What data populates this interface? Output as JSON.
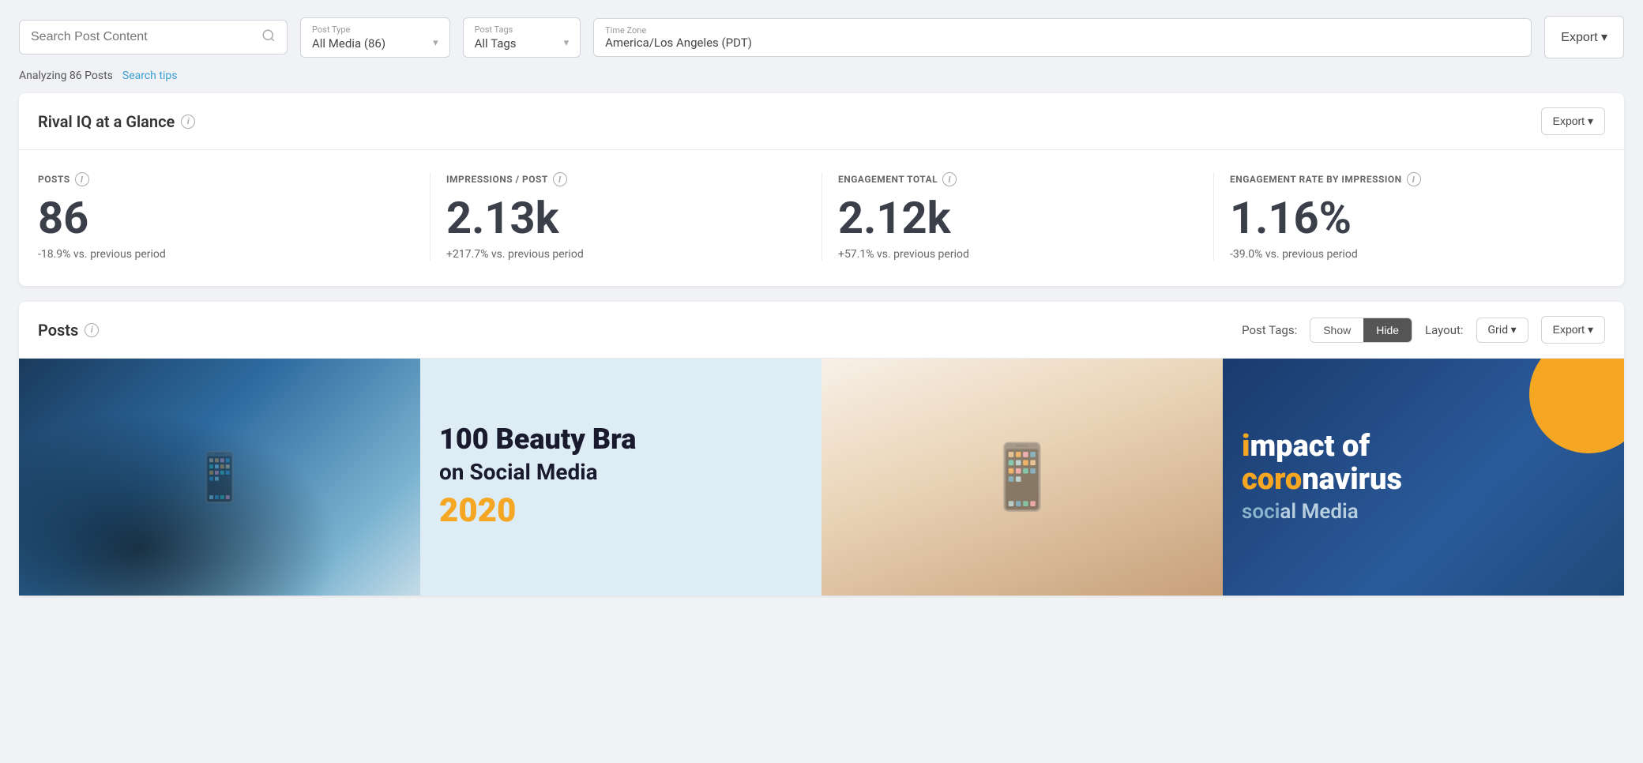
{
  "toolbar": {
    "search_placeholder": "Search Post Content",
    "post_type_label": "Post Type",
    "post_type_value": "All Media (86)",
    "post_tags_label": "Post Tags",
    "post_tags_value": "All Tags",
    "timezone_label": "Time Zone",
    "timezone_value": "America/Los Angeles (PDT)",
    "export_label": "Export ▾"
  },
  "analyzing": {
    "text": "Analyzing 86 Posts",
    "search_tips": "Search tips"
  },
  "glance": {
    "title": "Rival IQ at a Glance",
    "export_label": "Export ▾",
    "stats": [
      {
        "label": "POSTS",
        "value": "86",
        "change": "-18.9% vs. previous period"
      },
      {
        "label": "IMPRESSIONS / POST",
        "value": "2.13k",
        "change": "+217.7% vs. previous period"
      },
      {
        "label": "ENGAGEMENT TOTAL",
        "value": "2.12k",
        "change": "+57.1% vs. previous period"
      },
      {
        "label": "ENGAGEMENT RATE BY IMPRESSION",
        "value": "1.16%",
        "change": "-39.0% vs. previous period"
      }
    ]
  },
  "posts_section": {
    "title": "Posts",
    "post_tags_label": "Post Tags:",
    "show_label": "Show",
    "hide_label": "Hide",
    "layout_label": "Layout:",
    "grid_label": "Grid ▾",
    "export_label": "Export ▾",
    "images": [
      {
        "type": "people",
        "alt": "People using phones"
      },
      {
        "type": "beauty",
        "title": "100 Beauty Bra",
        "subtitle": "on Social Media",
        "year": "2020",
        "alt": "100 Beauty Brands on Social Media 2020"
      },
      {
        "type": "phone-hand",
        "alt": "Person holding phone"
      },
      {
        "type": "impact",
        "line1": "mpact of",
        "line2": "navirus",
        "line3": "al Media",
        "alt": "Impact of Coronavirus on Social Media"
      }
    ]
  },
  "icons": {
    "search": "🔍",
    "info": "i",
    "chevron_down": "▾"
  }
}
